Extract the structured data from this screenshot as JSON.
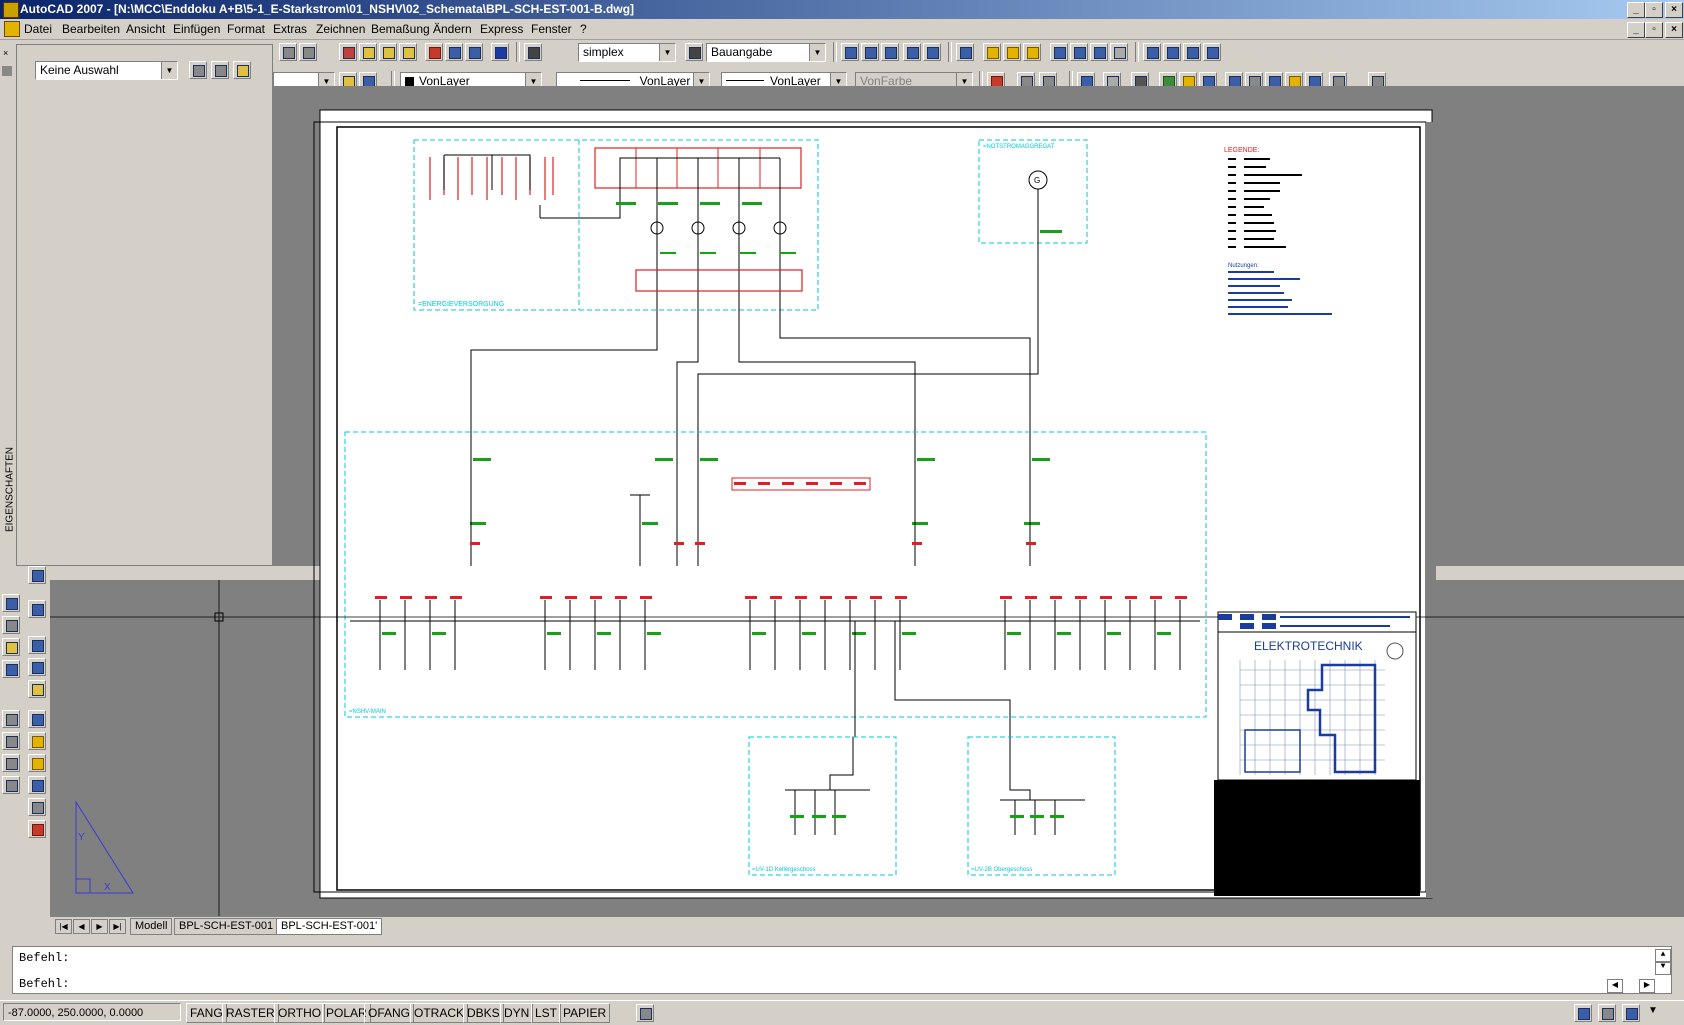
{
  "window": {
    "title": "AutoCAD 2007 - [N:\\MCC\\Enddoku A+B\\5-1_E-Starkstrom\\01_NSHV\\02_Schemata\\BPL-SCH-EST-001-B.dwg]",
    "minimize": "_",
    "restore": "▫",
    "close": "×"
  },
  "menu": [
    "Datei",
    "Bearbeiten",
    "Ansicht",
    "Einfügen",
    "Format",
    "Extras",
    "Zeichnen",
    "Bemaßung",
    "Ändern",
    "Express",
    "Fenster",
    "?"
  ],
  "toolbar": {
    "text_style": "simplex",
    "dim_style": "Bauangabe",
    "layer_color": "VonLayer",
    "linetype": "VonLayer",
    "lineweight": "VonLayer",
    "plotstyle": "VonFarbe"
  },
  "properties": {
    "selection": "Keine Auswahl",
    "palette_label": "EIGENSCHAFTEN"
  },
  "drawing": {
    "title_block_heading": "ELEKTROTECHNIK",
    "legend_title": "LEGENDE:",
    "notes_title": "Nutzungen:",
    "box_labels": {
      "energieversorgung": "=ENERGIEVERSORGUNG",
      "notstrom": "=NOTSTROMAGGREGAT",
      "nshv": "=NSHV-MAIN",
      "uv1": "=UV-1D Kellergeschoss",
      "uv2": "=UV-2B Obergeschoss"
    }
  },
  "layout_tabs": [
    "Modell",
    "BPL-SCH-EST-001",
    "BPL-SCH-EST-001'"
  ],
  "active_tab": "BPL-SCH-EST-001'",
  "command": {
    "line1": "Befehl:",
    "line2": "Befehl:"
  },
  "status": {
    "coords": "-87.0000, 250.0000, 0.0000",
    "toggles": [
      "FANG",
      "RASTER",
      "ORTHO",
      "POLAR",
      "OFANG",
      "OTRACK",
      "DBKS",
      "DYN",
      "LST",
      "PAPIER"
    ]
  },
  "colors": {
    "title_from": "#0a246a",
    "title_to": "#a6caf0",
    "cad_red": "#e02020",
    "cad_cyan": "#00c8d8",
    "cad_green": "#18a018",
    "cad_blue": "#1a3ca0"
  }
}
